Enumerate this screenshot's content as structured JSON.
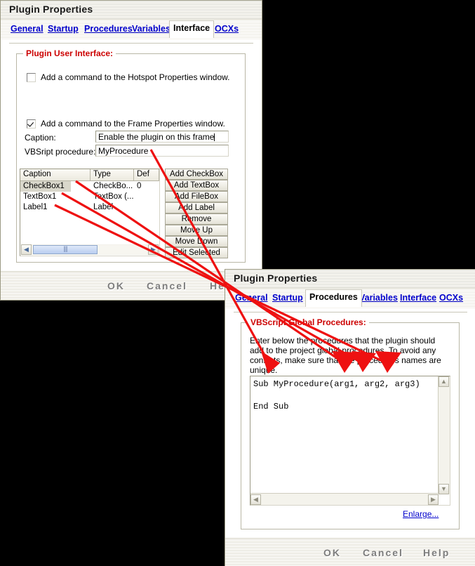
{
  "dialog1": {
    "title": "Plugin Properties",
    "tabs": [
      {
        "label": "General",
        "active": false
      },
      {
        "label": "Startup",
        "active": false
      },
      {
        "label": "Procedures",
        "active": false
      },
      {
        "label": "Variables",
        "active": false
      },
      {
        "label": "Interface",
        "active": true
      },
      {
        "label": "OCXs",
        "active": false
      }
    ],
    "group_title": "Plugin User Interface:",
    "hotspot_checkbox": {
      "label": "Add a command to the Hotspot Properties window.",
      "checked": false
    },
    "frame_checkbox": {
      "label": "Add a command to the Frame Properties window.",
      "checked": true
    },
    "caption_label": "Caption:",
    "caption_value": "Enable the plugin on this frame",
    "procedure_label": "VBSript procedure:",
    "procedure_value": "MyProcedure",
    "listview": {
      "columns": [
        "Caption",
        "Type",
        "Def"
      ],
      "rows": [
        {
          "caption": "CheckBox1",
          "type": "CheckBo...",
          "def": "0",
          "selected": true
        },
        {
          "caption": "TextBox1",
          "type": "TextBox (...",
          "def": "",
          "selected": false
        },
        {
          "caption": "Label1",
          "type": "Label",
          "def": "",
          "selected": false
        }
      ]
    },
    "side_buttons": [
      "Add CheckBox",
      "Add TextBox",
      "Add FileBox",
      "Add Label",
      "Remove",
      "Move Up",
      "Move Down",
      "Edit Selected"
    ],
    "footer_buttons": [
      "OK",
      "Cancel",
      "Help"
    ]
  },
  "dialog2": {
    "title": "Plugin Properties",
    "tabs": [
      {
        "label": "General",
        "active": false
      },
      {
        "label": "Startup",
        "active": false
      },
      {
        "label": "Procedures",
        "active": true
      },
      {
        "label": "Variables",
        "active": false
      },
      {
        "label": "Interface",
        "active": false
      },
      {
        "label": "OCXs",
        "active": false
      }
    ],
    "group_title": "VBScript Global Procedures:",
    "description": "Enter below the procedures that the plugin should add to the project global procedures. To avoid any conflicts, make sure that the procedures names are unique.",
    "code": "Sub MyProcedure(arg1, arg2, arg3)\n\nEnd Sub",
    "enlarge_link": "Enlarge...",
    "footer_buttons": [
      "OK",
      "Cancel",
      "Help"
    ]
  },
  "annotations": {
    "color": "#ee1111",
    "description": "Four red arrows drawn from the Interface tab controls of the first dialog converging toward the procedure code line in the second dialog"
  },
  "icons": {
    "scroll_left": "◀",
    "scroll_right": "▶",
    "scroll_up": "▲",
    "scroll_down": "▼"
  }
}
